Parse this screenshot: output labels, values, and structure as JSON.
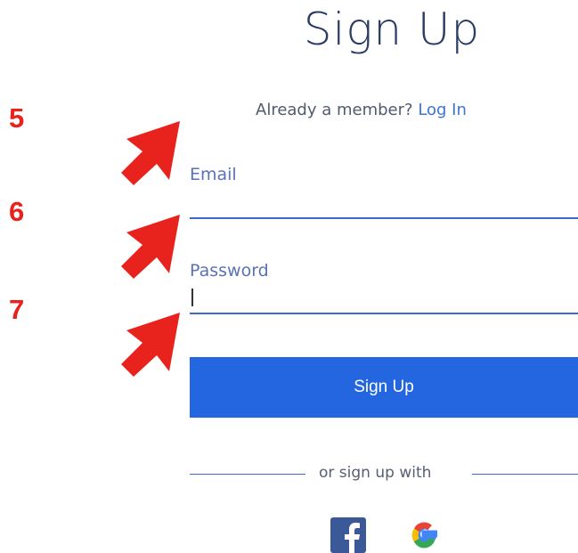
{
  "form": {
    "title": "Sign Up",
    "already_member_text": "Already a member?",
    "login_link": "Log In",
    "email_label": "Email",
    "email_value": "",
    "password_label": "Password",
    "password_value": "",
    "submit_label": "Sign Up",
    "divider_text": "or sign up with"
  },
  "annotations": {
    "steps": [
      "5",
      "6",
      "7"
    ],
    "color": "#e8231d"
  },
  "social": {
    "icons": [
      "facebook-icon",
      "google-icon"
    ],
    "facebook_color": "#3b5998"
  },
  "colors": {
    "accent": "#2466e0",
    "title": "#2b3c62",
    "label": "#5a72b6"
  }
}
